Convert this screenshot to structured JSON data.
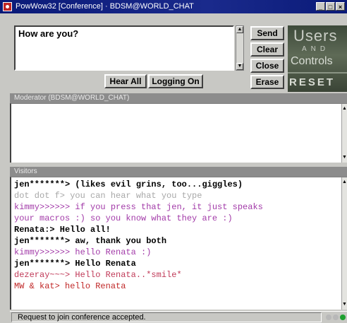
{
  "window": {
    "title": "PowWow32 [Conference] · BDSM@WORLD_CHAT",
    "controls": [
      "_",
      "□",
      "×"
    ]
  },
  "compose": {
    "value": "How are you?"
  },
  "buttons": {
    "send": "Send",
    "clear": "Clear",
    "close": "Close",
    "erase": "Erase",
    "hear_all": "Hear All",
    "logging_on": "Logging On"
  },
  "logo": {
    "line1": "Users",
    "line2": "AND",
    "line3": "Controls",
    "line4": "RESET"
  },
  "moderator": {
    "header": "Moderator (BDSM@WORLD_CHAT)"
  },
  "visitors": {
    "header": "Visitors",
    "messages": [
      {
        "text": "jen*******> (likes evil grins, too...giggles)",
        "color": "#000000",
        "bold": true
      },
      {
        "text": "dot dot f> you can hear what you type",
        "color": "#a8a8a8",
        "bold": false
      },
      {
        "text": "kimmy>>>>>> if you press that jen, it just speaks",
        "color": "#a23aa8",
        "bold": false
      },
      {
        "text": "your macros :)  so you know what they are :)",
        "color": "#a23aa8",
        "bold": false
      },
      {
        "text": "Renata:> Hello all!",
        "color": "#000000",
        "bold": true
      },
      {
        "text": "jen*******> aw, thank you both",
        "color": "#000000",
        "bold": true
      },
      {
        "text": "kimmy>>>>>> hello Renata :)",
        "color": "#a23aa8",
        "bold": false
      },
      {
        "text": "jen*******> Hello Renata",
        "color": "#000000",
        "bold": true
      },
      {
        "text": "dezeray~~~> Hello Renata..*smile*",
        "color": "#c03a58",
        "bold": false
      },
      {
        "text": "MW & kat> hello Renata",
        "color": "#c02828",
        "bold": false
      }
    ]
  },
  "status": {
    "text": "Request to join conference accepted."
  },
  "colors": {
    "title_bar": "#0a1a78",
    "lamp_idle": "#b8b8b8",
    "lamp_active": "#1ea030"
  }
}
